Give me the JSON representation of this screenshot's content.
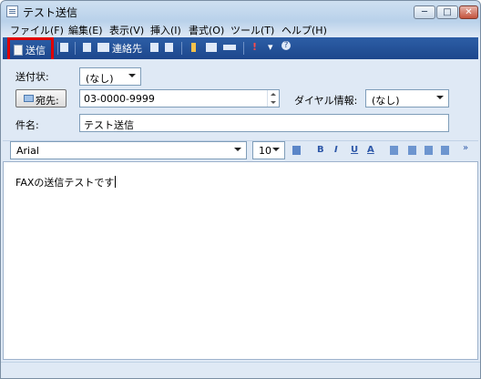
{
  "window": {
    "title": "テスト送信",
    "controls": {
      "minimize": "─",
      "maximize": "□",
      "close": "✕"
    }
  },
  "menu": [
    "ファイル(F)",
    "編集(E)",
    "表示(V)",
    "挿入(I)",
    "書式(O)",
    "ツール(T)",
    "ヘルプ(H)"
  ],
  "toolbar": {
    "send_label": "送信",
    "contacts_label": "連絡先",
    "priority_mark": "!",
    "dropdown_mark": "▾",
    "help_mark": "?"
  },
  "header": {
    "cover_label": "送付状:",
    "cover_value": "(なし)",
    "to_button_label": "宛先:",
    "to_value": "03-0000-9999",
    "dial_label": "ダイヤル情報:",
    "dial_value": "(なし)",
    "subject_label": "件名:",
    "subject_value": "テスト送信"
  },
  "format": {
    "font": "Arial",
    "size": "10",
    "bold": "B",
    "italic": "I",
    "underline": "U",
    "color": "A",
    "more": "»"
  },
  "body": {
    "text": "FAXの送信テストです"
  },
  "colors": {
    "toolbar": "#1d478c",
    "highlight": "#e00000",
    "body_border": "#9eb2cc"
  }
}
